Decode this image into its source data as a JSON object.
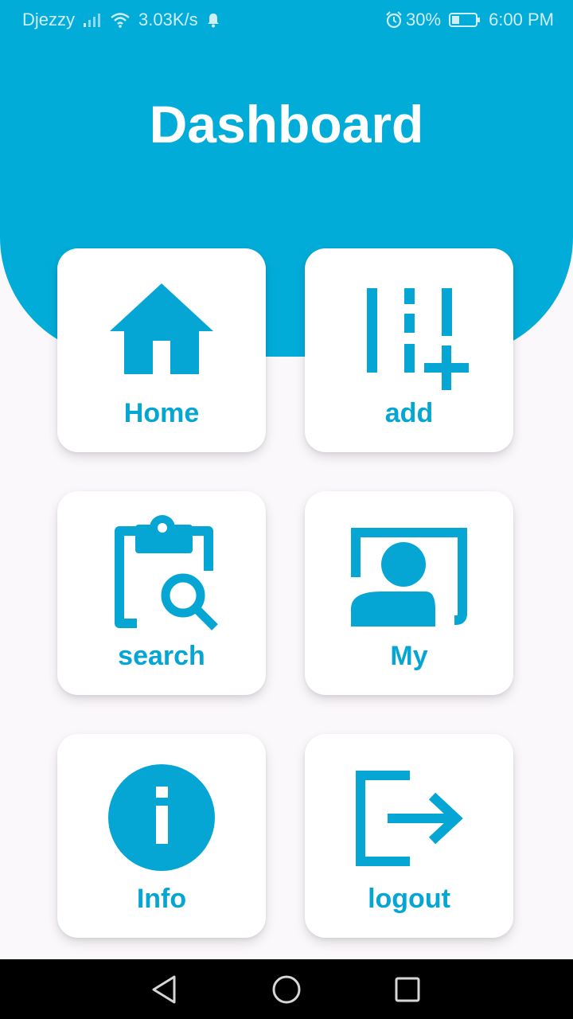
{
  "status_bar": {
    "carrier": "Djezzy",
    "net_speed": "3.03K/s",
    "battery": "30%",
    "time": "6:00 PM",
    "icons": [
      "signal-icon",
      "wifi-icon",
      "notification-bell-icon",
      "alarm-icon",
      "battery-icon"
    ]
  },
  "header": {
    "title": "Dashboard"
  },
  "menu": {
    "home": {
      "label": "Home",
      "icon": "home-icon"
    },
    "add": {
      "label": "add",
      "icon": "add-column-icon"
    },
    "search": {
      "label": "search",
      "icon": "clipboard-search-icon"
    },
    "my": {
      "label": "My",
      "icon": "account-box-icon"
    },
    "info": {
      "label": "Info",
      "icon": "info-icon"
    },
    "logout": {
      "label": "logout",
      "icon": "logout-icon"
    }
  },
  "nav_bar": {
    "icons": [
      "back-icon",
      "home-circle-icon",
      "recents-icon"
    ]
  },
  "colors": {
    "accent": "#02acd9",
    "label": "#06a6d4",
    "background": "#fbf8fc"
  }
}
